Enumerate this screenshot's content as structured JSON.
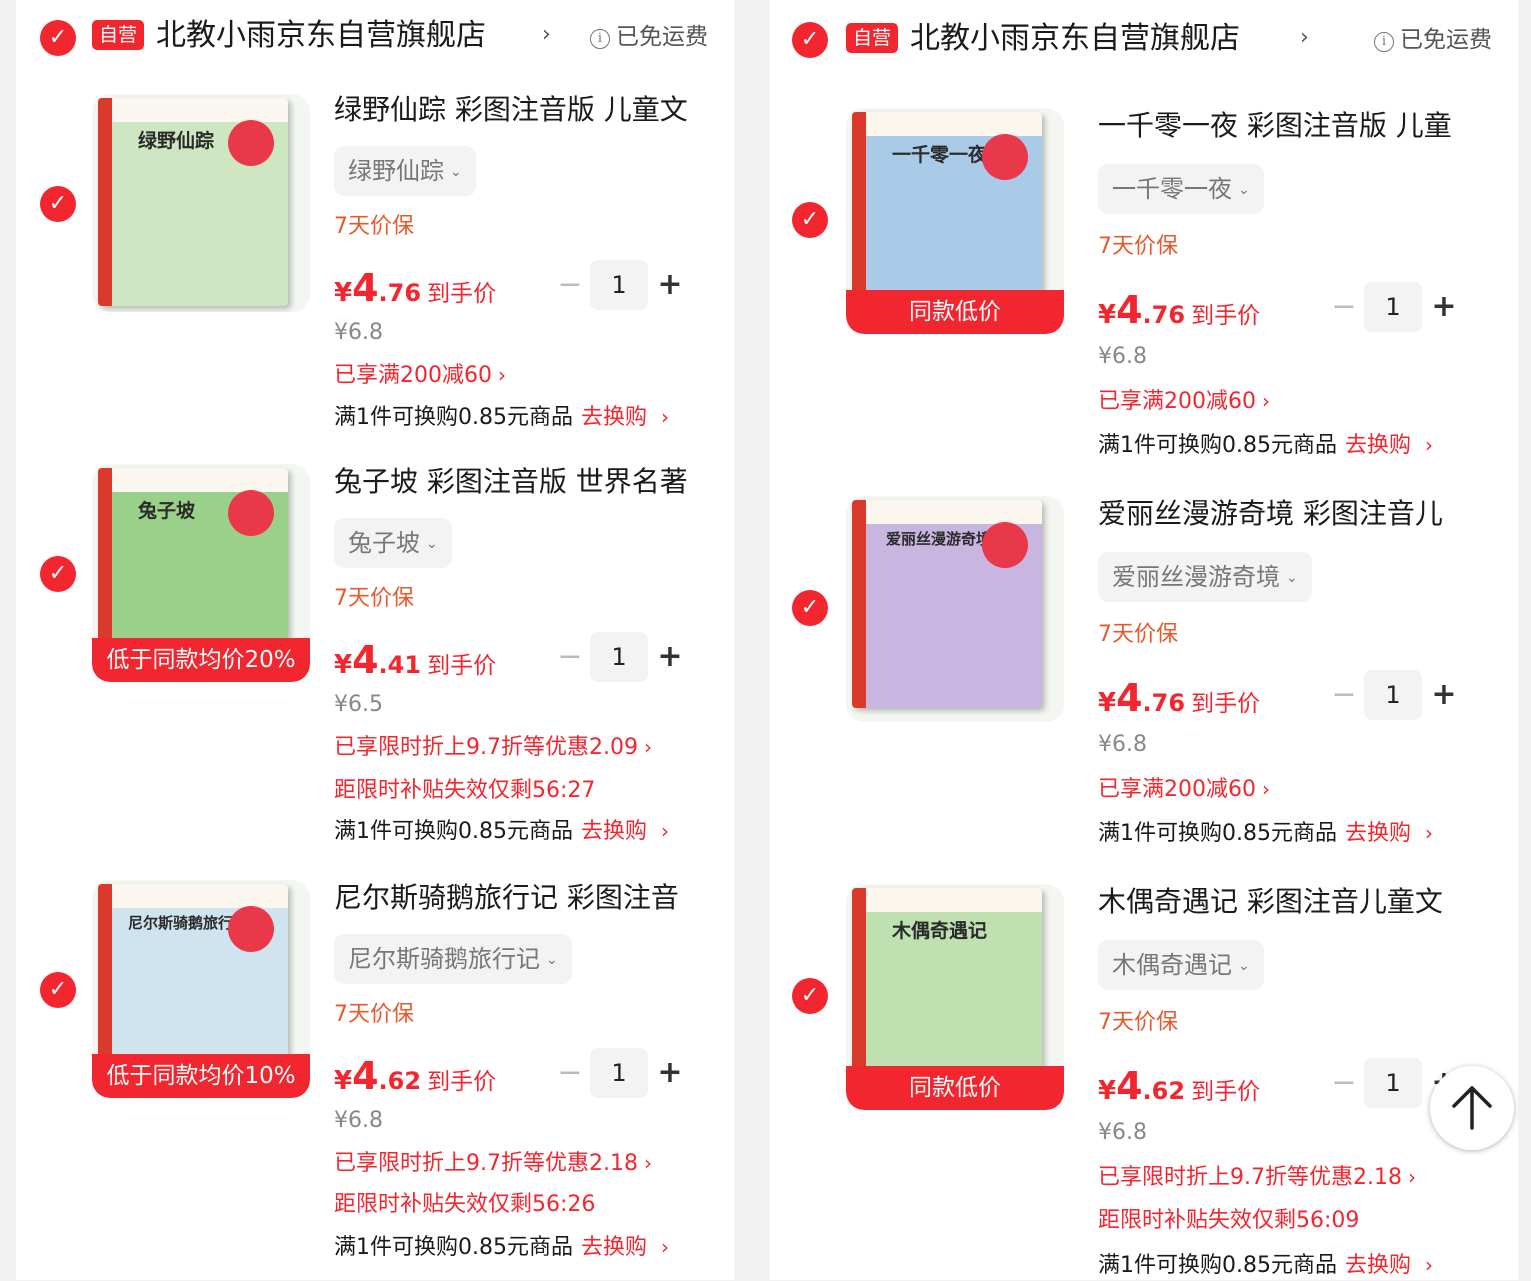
{
  "stores": [
    {
      "badge": "自营",
      "name": "北教小雨京东自营旗舰店",
      "shipping": "已免运费",
      "items": [
        {
          "title": "绿野仙踪 彩图注音版 儿童文",
          "book_title": "绿野仙踪",
          "sku": "绿野仙踪",
          "guarantee": "7天价保",
          "price_yen": "¥",
          "price_int": "4",
          "price_dec": ".76",
          "price_unit": "到手价",
          "quantity": "1",
          "original_price": "¥6.8",
          "promo": "已享满200减60",
          "exchange_text": "满1件可换购0.85元商品",
          "exchange_link": "去换购",
          "cover_color": "#cfe6c2"
        },
        {
          "title": "兔子坡 彩图注音版 世界名著",
          "book_title": "兔子坡",
          "sku": "兔子坡",
          "guarantee": "7天价保",
          "ribbon": "低于同款均价20%",
          "price_yen": "¥",
          "price_int": "4",
          "price_dec": ".41",
          "price_unit": "到手价",
          "quantity": "1",
          "original_price": "¥6.5",
          "promo": "已享限时折上9.7折等优惠2.09",
          "countdown": "距限时补贴失效仅剩56:27",
          "exchange_text": "满1件可换购0.85元商品",
          "exchange_link": "去换购",
          "cover_color": "#9bd08a"
        },
        {
          "title": "尼尔斯骑鹅旅行记 彩图注音",
          "book_title": "尼尔斯骑鹅旅行记",
          "sku": "尼尔斯骑鹅旅行记",
          "guarantee": "7天价保",
          "ribbon": "低于同款均价10%",
          "price_yen": "¥",
          "price_int": "4",
          "price_dec": ".62",
          "price_unit": "到手价",
          "quantity": "1",
          "original_price": "¥6.8",
          "promo": "已享限时折上9.7折等优惠2.18",
          "countdown": "距限时补贴失效仅剩56:26",
          "exchange_text": "满1件可换购0.85元商品",
          "exchange_link": "去换购",
          "cover_color": "#cfe4ee"
        }
      ]
    },
    {
      "badge": "自营",
      "name": "北教小雨京东自营旗舰店",
      "shipping": "已免运费",
      "items": [
        {
          "title": "一千零一夜 彩图注音版 儿童",
          "book_title": "一千零一夜",
          "sku": "一千零一夜",
          "guarantee": "7天价保",
          "ribbon": "同款低价",
          "price_yen": "¥",
          "price_int": "4",
          "price_dec": ".76",
          "price_unit": "到手价",
          "quantity": "1",
          "original_price": "¥6.8",
          "promo": "已享满200减60",
          "exchange_text": "满1件可换购0.85元商品",
          "exchange_link": "去换购",
          "cover_color": "#a9cbe8"
        },
        {
          "title": "爱丽丝漫游奇境 彩图注音儿",
          "book_title": "爱丽丝漫游奇境",
          "sku": "爱丽丝漫游奇境",
          "guarantee": "7天价保",
          "price_yen": "¥",
          "price_int": "4",
          "price_dec": ".76",
          "price_unit": "到手价",
          "quantity": "1",
          "original_price": "¥6.8",
          "promo": "已享满200减60",
          "exchange_text": "满1件可换购0.85元商品",
          "exchange_link": "去换购",
          "cover_color": "#c9b6e0"
        },
        {
          "title": "木偶奇遇记 彩图注音儿童文",
          "book_title": "木偶奇遇记",
          "sku": "木偶奇遇记",
          "guarantee": "7天价保",
          "ribbon": "同款低价",
          "price_yen": "¥",
          "price_int": "4",
          "price_dec": ".62",
          "price_unit": "到手价",
          "quantity": "1",
          "original_price": "¥6.8",
          "promo": "已享限时折上9.7折等优惠2.18",
          "countdown": "距限时补贴失效仅剩56:09",
          "exchange_text": "满1件可换购0.85元商品",
          "exchange_link": "去换购",
          "cover_color": "#bfe0b0"
        }
      ]
    }
  ],
  "colors": {
    "accent": "#f2262f",
    "guarantee": "#e55a2c"
  },
  "icons": {
    "check": "check-icon",
    "info": "info-icon",
    "back_to_top": "arrow-up-icon"
  }
}
